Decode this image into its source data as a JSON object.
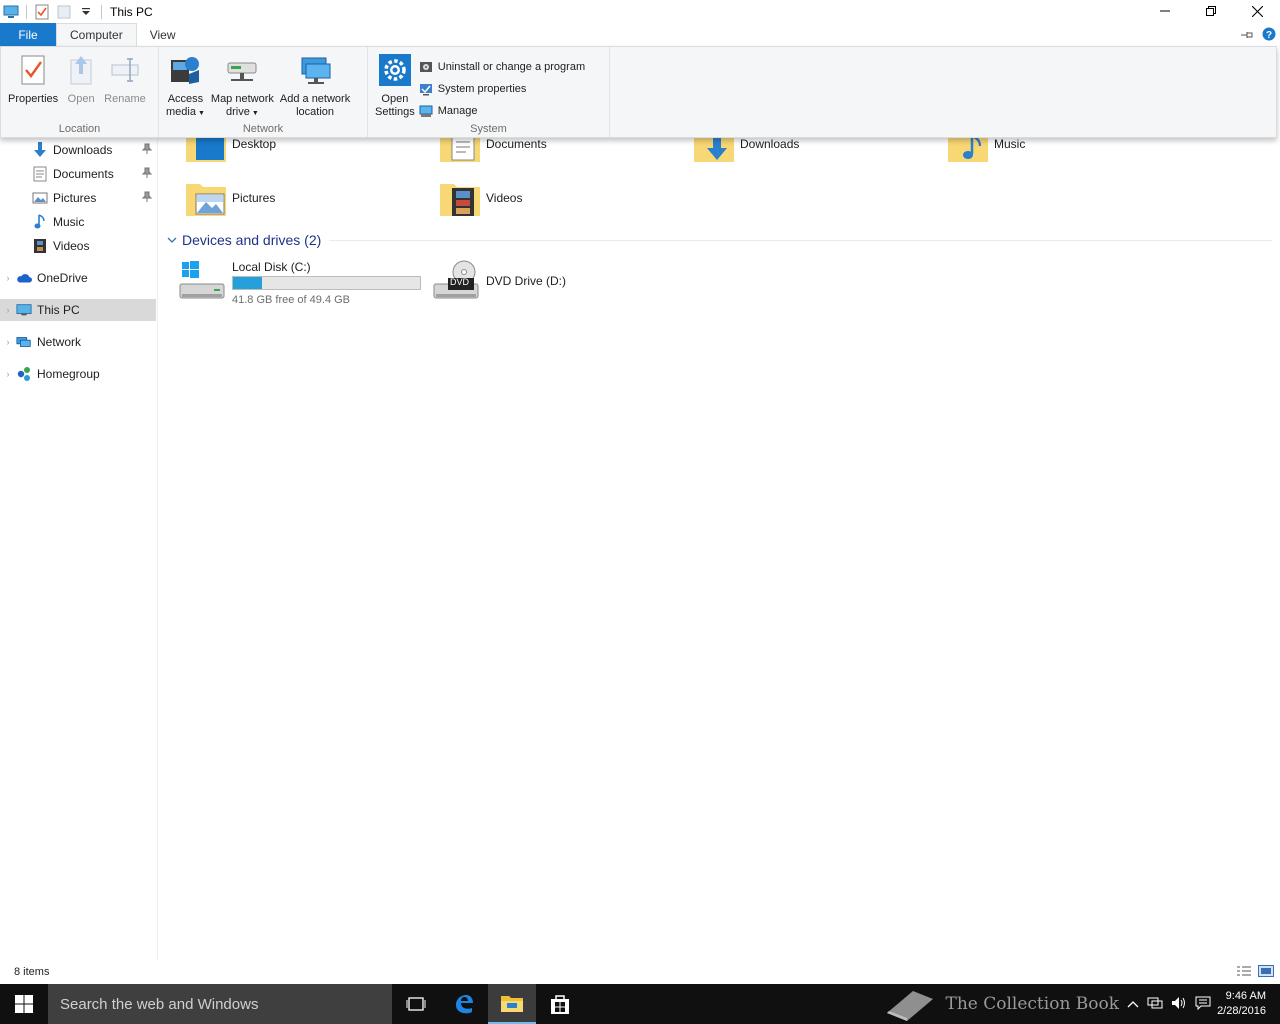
{
  "window": {
    "title": "This PC",
    "controls": {
      "minimize": "minimize",
      "maximize": "restore",
      "close": "close"
    }
  },
  "ribbon_tabs": {
    "file": "File",
    "computer": "Computer",
    "view": "View"
  },
  "ribbon": {
    "location": {
      "label": "Location",
      "properties": "Properties",
      "open": "Open",
      "rename": "Rename"
    },
    "network": {
      "label": "Network",
      "access_media_line1": "Access",
      "access_media_line2": "media",
      "map_drive_line1": "Map network",
      "map_drive_line2": "drive",
      "add_location_line1": "Add a network",
      "add_location_line2": "location"
    },
    "system": {
      "label": "System",
      "open_settings_line1": "Open",
      "open_settings_line2": "Settings",
      "uninstall": "Uninstall or change a program",
      "system_properties": "System properties",
      "manage": "Manage"
    }
  },
  "nav": {
    "downloads": "Downloads",
    "documents": "Documents",
    "pictures": "Pictures",
    "music": "Music",
    "videos": "Videos",
    "onedrive": "OneDrive",
    "this_pc": "This PC",
    "network": "Network",
    "homegroup": "Homegroup"
  },
  "folders": {
    "desktop": "Desktop",
    "documents": "Documents",
    "downloads": "Downloads",
    "music": "Music",
    "pictures": "Pictures",
    "videos": "Videos"
  },
  "devices": {
    "header": "Devices and drives (2)",
    "local_disk": {
      "name": "Local Disk (C:)",
      "free_text": "41.8 GB free of 49.4 GB",
      "used_fraction": 0.154
    },
    "dvd": {
      "name": "DVD Drive (D:)",
      "badge": "DVD"
    }
  },
  "status": {
    "items": "8 items"
  },
  "taskbar": {
    "search_placeholder": "Search the web and Windows",
    "watermark": "The Collection Book",
    "time": "9:46 AM",
    "date": "2/28/2016"
  },
  "colors": {
    "accent": "#1979ca",
    "folder": "#f8d775",
    "drive_bar": "#26a0da",
    "taskbar": "#101010"
  }
}
